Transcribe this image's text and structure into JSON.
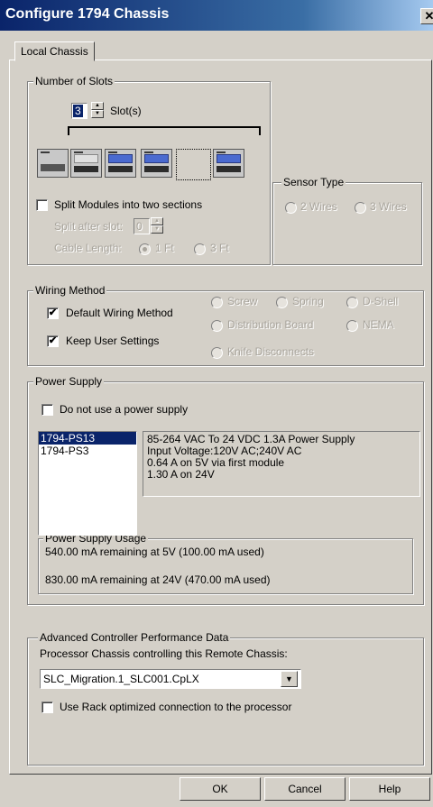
{
  "dialog": {
    "title": "Configure 1794 Chassis",
    "close_glyph": "✕"
  },
  "tab": {
    "label": "Local Chassis"
  },
  "slots": {
    "group_label": "Number of Slots",
    "value": "3",
    "unit_label": "Slot(s)",
    "split_label": "Split Modules into two sections",
    "split_after_label": "Split after slot:",
    "split_after_value": "0",
    "cable_length_label": "Cable Length:",
    "cable_options": [
      "1 Ft",
      "3 Ft"
    ],
    "cable_selected": "1 Ft"
  },
  "sensor": {
    "group_label": "Sensor Type",
    "options": [
      "2 Wires",
      "3 Wires"
    ]
  },
  "wiring": {
    "group_label": "Wiring Method",
    "default_label": "Default Wiring Method",
    "keep_label": "Keep User Settings",
    "options": [
      "Screw",
      "Spring",
      "D-Shell",
      "Distribution Board",
      "NEMA",
      "Knife Disconnects"
    ]
  },
  "power": {
    "group_label": "Power Supply",
    "no_supply_label": "Do not use a power supply",
    "list": [
      "1794-PS13",
      "1794-PS3"
    ],
    "selected": "1794-PS13",
    "description": [
      "85-264 VAC To 24 VDC 1.3A Power Supply",
      "Input Voltage:120V AC;240V AC",
      "0.64 A on 5V via first module",
      "1.30 A on 24V"
    ],
    "usage_label": "Power Supply Usage",
    "usage_5v": "540.00 mA remaining at 5V (100.00 mA used)",
    "usage_24v": "830.00 mA remaining at 24V (470.00 mA used)"
  },
  "advanced": {
    "group_label": "Advanced Controller Performance Data",
    "processor_label": "Processor Chassis controlling this Remote Chassis:",
    "processor_value": "SLC_Migration.1_SLC001.CpLX",
    "rack_label": "Use Rack optimized connection to the processor"
  },
  "buttons": {
    "ok": "OK",
    "cancel": "Cancel",
    "help": "Help"
  },
  "checks": {
    "default_wiring": true,
    "keep_user": true,
    "split": false,
    "no_supply": false,
    "rack_optimized": false
  },
  "icons": {
    "check_glyph": "✔",
    "arrow_up": "▲",
    "arrow_down": "▼"
  }
}
